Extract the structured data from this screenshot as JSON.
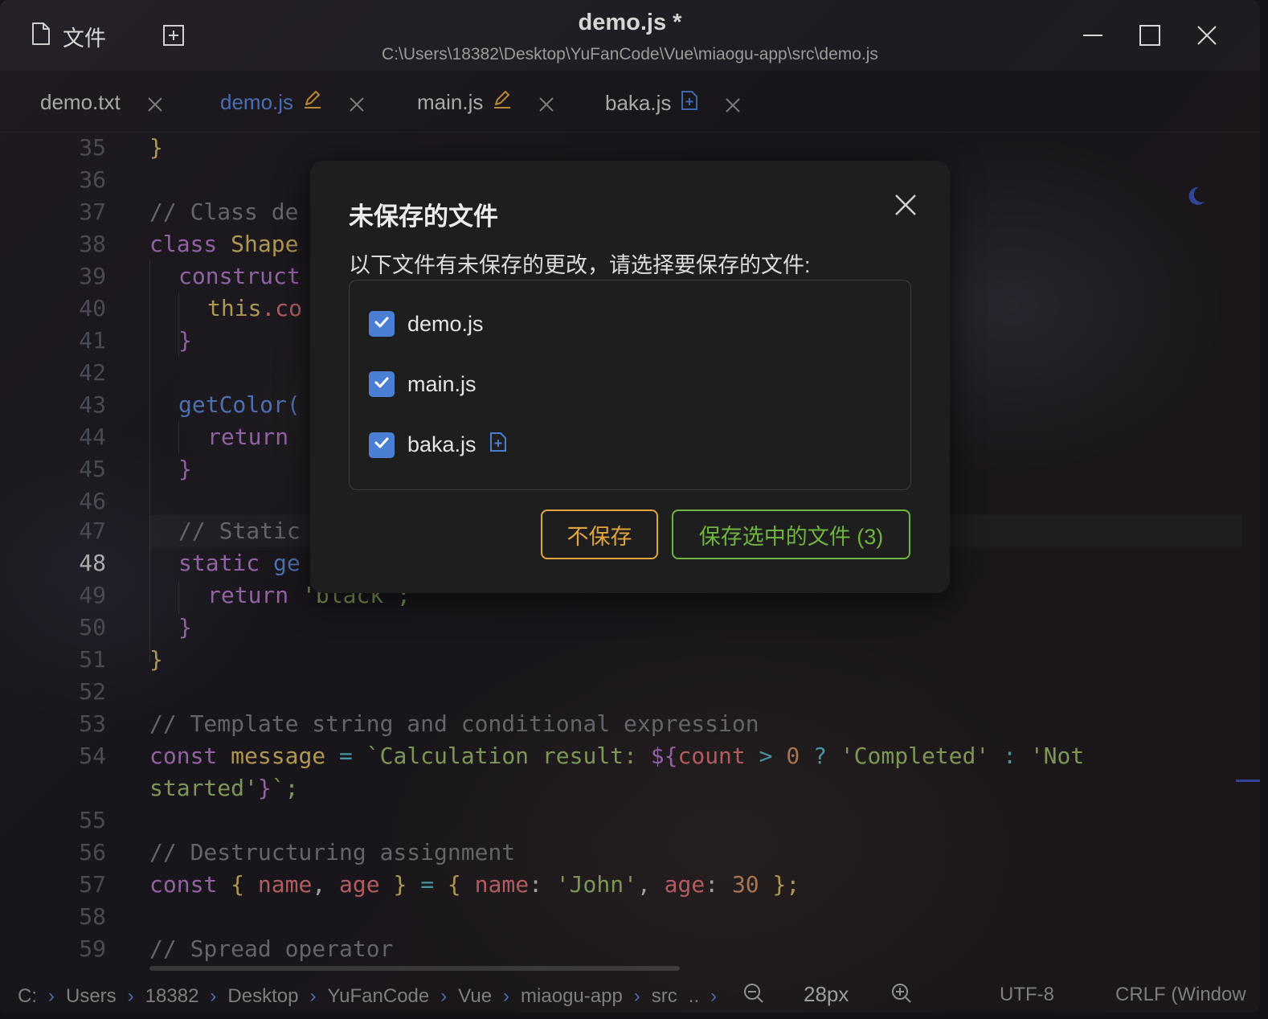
{
  "window": {
    "title": "demo.js *",
    "path": "C:\\Users\\18382\\Desktop\\YuFanCode\\Vue\\miaogu-app\\src\\demo.js",
    "file_menu_label": "文件"
  },
  "tabs": [
    {
      "label": "demo.txt",
      "status": "",
      "active": false
    },
    {
      "label": "demo.js",
      "status": "modified",
      "active": true
    },
    {
      "label": "main.js",
      "status": "modified",
      "active": false
    },
    {
      "label": "baka.js",
      "status": "new",
      "active": false
    }
  ],
  "editor": {
    "current_line": "48",
    "lines": [
      {
        "n": "35"
      },
      {
        "n": "36"
      },
      {
        "n": "37"
      },
      {
        "n": "38"
      },
      {
        "n": "39"
      },
      {
        "n": "40"
      },
      {
        "n": "41"
      },
      {
        "n": "42"
      },
      {
        "n": "43"
      },
      {
        "n": "44"
      },
      {
        "n": "45"
      },
      {
        "n": "46"
      },
      {
        "n": "47"
      },
      {
        "n": "48"
      },
      {
        "n": "49"
      },
      {
        "n": "50"
      },
      {
        "n": "51"
      },
      {
        "n": "52"
      },
      {
        "n": "53"
      },
      {
        "n": "54"
      },
      {
        "n": ""
      },
      {
        "n": "55"
      },
      {
        "n": "56"
      },
      {
        "n": "57"
      },
      {
        "n": "58"
      },
      {
        "n": "59"
      }
    ],
    "code": {
      "l37": "// Class de",
      "l38_kw": "class",
      "l38_cls": "Shape",
      "l39": "construct",
      "l40_this": "this",
      "l40_rest": ".co",
      "l43": "getColor(",
      "l44": "return",
      "l47": "// Static",
      "l48_kw": "static",
      "l48_fn": "ge",
      "l49_kw": "return",
      "l49_str": "'black';",
      "l53": "// Template string and conditional expression",
      "l54_kw": "const",
      "l54_var": "message",
      "l54_eq": "=",
      "l54_s1": "`Calculation result: ",
      "l54_interp": "${",
      "l54_count": "count",
      "l54_gt": ">",
      "l54_zero": "0",
      "l54_q": "?",
      "l54_c": "'Completed'",
      "l54_colon": ":",
      "l54_not": "'Not",
      "l54b_str": "started'",
      "l54b_close": "}",
      "l54b_end": "`;",
      "l56": "// Destructuring assignment",
      "l57_kw": "const",
      "l57_b1": "{",
      "l57_name": "name",
      "l57_comma": ",",
      "l57_age": "age",
      "l57_b2": "}",
      "l57_eq": "=",
      "l57_b3": "{",
      "l57_k1": "name",
      "l57_c1": ":",
      "l57_john": "'John'",
      "l57_comma2": ",",
      "l57_k2": "age",
      "l57_c2": ":",
      "l57_30": "30",
      "l57_end": "};",
      "l59": "// Spread operator",
      "brace": "}"
    }
  },
  "statusbar": {
    "breadcrumbs": [
      "C:",
      "Users",
      "18382",
      "Desktop",
      "YuFanCode",
      "Vue",
      "miaogu-app",
      "src"
    ],
    "overflow": "..",
    "zoom": "28px",
    "encoding": "UTF-8",
    "line_ending": "CRLF (Window"
  },
  "dialog": {
    "title": "未保存的文件",
    "message": "以下文件有未保存的更改，请选择要保存的文件:",
    "files": [
      {
        "name": "demo.js",
        "checked": true,
        "new": false
      },
      {
        "name": "main.js",
        "checked": true,
        "new": false
      },
      {
        "name": "baka.js",
        "checked": true,
        "new": true
      }
    ],
    "dont_save_label": "不保存",
    "save_label": "保存选中的文件 (3)"
  },
  "colors": {
    "accent": "#4a7fd4",
    "modified": "#e2a43e",
    "save": "#6fb43e"
  },
  "icons": [
    "file-icon",
    "new-tab-icon",
    "minimize-icon",
    "maximize-icon",
    "close-icon",
    "edit-pencil-icon",
    "new-file-icon",
    "moon-icon",
    "zoom-out-icon",
    "zoom-in-icon",
    "checkmark-icon"
  ]
}
